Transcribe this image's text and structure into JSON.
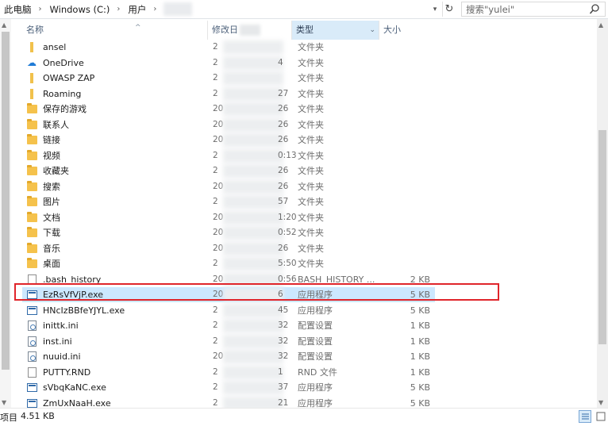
{
  "address": {
    "crumbs": [
      "此电脑",
      "Windows (C:)",
      "用户"
    ],
    "search_placeholder": "搜索\"yulei\""
  },
  "columns": {
    "name": "名称",
    "modified": "修改日",
    "type": "类型",
    "size": "大小"
  },
  "files": [
    {
      "name": "ansel",
      "date": "2",
      "type": "文件夹",
      "size": "",
      "icon": "folder-icon"
    },
    {
      "name": "OneDrive",
      "date": "2",
      "type": "文件夹",
      "size": "",
      "icon": "onedrive-icon"
    },
    {
      "name": "OWASP ZAP",
      "date": "2",
      "type": "文件夹",
      "size": "",
      "icon": "folder-icon"
    },
    {
      "name": "Roaming",
      "date": "2",
      "type": "文件夹",
      "size": "",
      "icon": "folder-icon"
    },
    {
      "name": "保存的游戏",
      "date": "20",
      "type": "文件夹",
      "size": "",
      "icon": "saved-games-icon"
    },
    {
      "name": "联系人",
      "date": "20",
      "type": "文件夹",
      "size": "",
      "icon": "contacts-icon"
    },
    {
      "name": "链接",
      "date": "20",
      "type": "文件夹",
      "size": "",
      "icon": "links-icon"
    },
    {
      "name": "视频",
      "date": "2",
      "type": "文件夹",
      "size": "",
      "icon": "videos-icon"
    },
    {
      "name": "收藏夹",
      "date": "2",
      "type": "文件夹",
      "size": "",
      "icon": "favorites-icon"
    },
    {
      "name": "搜索",
      "date": "20",
      "type": "文件夹",
      "size": "",
      "icon": "searches-icon"
    },
    {
      "name": "图片",
      "date": "2",
      "type": "文件夹",
      "size": "",
      "icon": "pictures-icon"
    },
    {
      "name": "文档",
      "date": "20",
      "type": "文件夹",
      "size": "",
      "icon": "documents-icon"
    },
    {
      "name": "下载",
      "date": "20",
      "type": "文件夹",
      "size": "",
      "icon": "downloads-icon"
    },
    {
      "name": "音乐",
      "date": "20",
      "type": "文件夹",
      "size": "",
      "icon": "music-icon"
    },
    {
      "name": "桌面",
      "date": "2",
      "type": "文件夹",
      "size": "",
      "icon": "desktop-icon"
    },
    {
      "name": ".bash_history",
      "date": "20",
      "type": "BASH_HISTORY ...",
      "size": "2 KB",
      "icon": "file-icon"
    },
    {
      "name": "EzRsVfVjP.exe",
      "date": "20",
      "type": "应用程序",
      "size": "5 KB",
      "icon": "exe-icon",
      "selected": true
    },
    {
      "name": "HNcIzBBfeYJYL.exe",
      "date": "2",
      "type": "应用程序",
      "size": "5 KB",
      "icon": "exe-icon"
    },
    {
      "name": "inittk.ini",
      "date": "2",
      "type": "配置设置",
      "size": "1 KB",
      "icon": "ini-icon"
    },
    {
      "name": "inst.ini",
      "date": "2",
      "type": "配置设置",
      "size": "1 KB",
      "icon": "ini-icon"
    },
    {
      "name": "nuuid.ini",
      "date": "20",
      "type": "配置设置",
      "size": "1 KB",
      "icon": "ini-icon"
    },
    {
      "name": "PUTTY.RND",
      "date": "2",
      "type": "RND 文件",
      "size": "1 KB",
      "icon": "file-icon"
    },
    {
      "name": "sVbqKaNC.exe",
      "date": "2",
      "type": "应用程序",
      "size": "5 KB",
      "icon": "exe-icon"
    },
    {
      "name": "ZmUxNaaH.exe",
      "date": "2",
      "type": "应用程序",
      "size": "5 KB",
      "icon": "exe-icon"
    }
  ],
  "date_suffixes": [
    "",
    "4",
    "",
    "27",
    "26",
    "26",
    "26",
    "0:13",
    "26",
    "26",
    "57",
    "1:20",
    "0:52",
    "26",
    "5:50",
    "0:56",
    "6",
    "45",
    "32",
    "32",
    "32",
    "1",
    "37",
    "21"
  ],
  "status": {
    "count": "项目",
    "size": "4.51 KB"
  }
}
